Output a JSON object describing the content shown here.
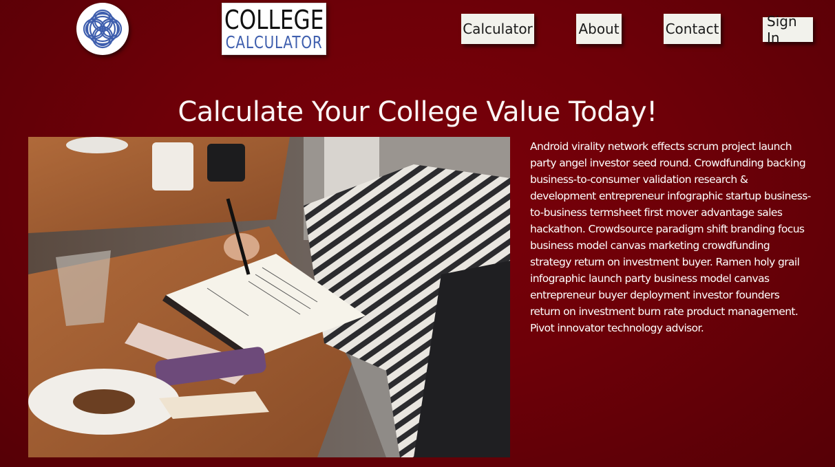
{
  "brand": {
    "logo_icon": "interlocking-knot-icon",
    "title_line1": "COLLEGE",
    "title_line2": "CALCULATOR"
  },
  "nav": {
    "calculator": "Calculator",
    "about": "About",
    "contact": "Contact",
    "sign_in": "Sign In"
  },
  "hero": {
    "title": "Calculate Your College Value Today!",
    "image_icon": "student-writing-photo",
    "blurb": "Android virality network effects scrum project launch party angel investor seed round. Crowdfunding backing business-to-consumer validation research & development entrepreneur infographic startup business-to-business termsheet first mover advantage sales hackathon. Crowdsource paradigm shift branding focus business model canvas marketing crowdfunding strategy return on investment buyer. Ramen holy grail infographic launch party business model canvas entrepreneur buyer deployment investor founders return on investment burn rate product management. Pivot innovator technology advisor."
  },
  "colors": {
    "background": "#6e0008",
    "button_bg": "#f2f2ec",
    "logo_blue": "#3f5fae",
    "text": "#ffffff"
  }
}
